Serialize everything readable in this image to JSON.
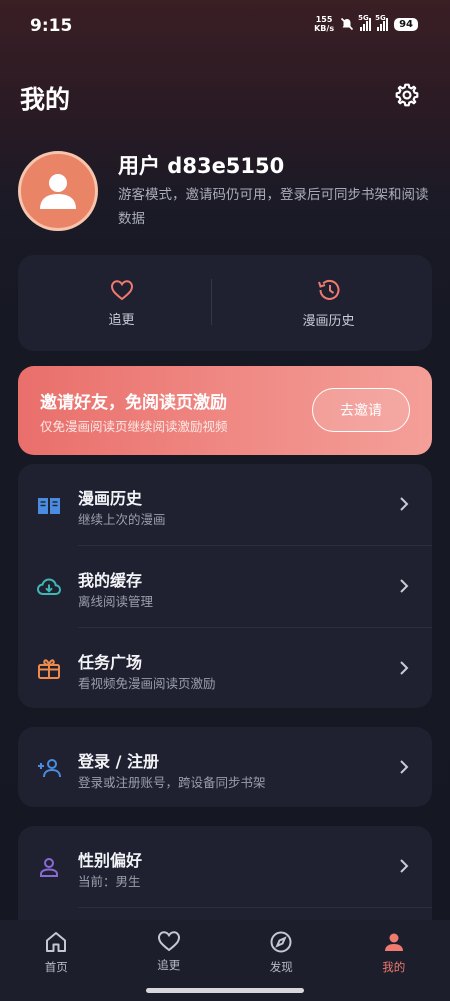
{
  "status_bar": {
    "time": "9:15",
    "net_speed_value": "155",
    "net_speed_unit": "KB/s",
    "sim1": "5G",
    "sim2": "5G",
    "battery": "94"
  },
  "header": {
    "title": "我的",
    "settings_icon": "gear-icon"
  },
  "profile": {
    "avatar_icon": "user-avatar-icon",
    "username": "用户 d83e5150",
    "description": "游客模式，邀请码仍可用，登录后可同步书架和阅读数据"
  },
  "quick_actions": [
    {
      "label": "追更",
      "icon": "heart-icon"
    },
    {
      "label": "漫画历史",
      "icon": "history-icon"
    }
  ],
  "invite": {
    "title": "邀请好友，免阅读页激励",
    "subtitle": "仅免漫画阅读页继续阅读激励视频",
    "button": "去邀请"
  },
  "menu_group_1": [
    {
      "title": "漫画历史",
      "subtitle": "继续上次的漫画",
      "icon": "book-icon"
    },
    {
      "title": "我的缓存",
      "subtitle": "离线阅读管理",
      "icon": "cloud-download-icon"
    },
    {
      "title": "任务广场",
      "subtitle": "看视频免漫画阅读页激励",
      "icon": "gift-icon"
    }
  ],
  "menu_group_2": [
    {
      "title": "登录 / 注册",
      "subtitle": "登录或注册账号，跨设备同步书架",
      "icon": "add-user-icon"
    }
  ],
  "menu_group_3": [
    {
      "title": "性别偏好",
      "subtitle": "当前：男生",
      "icon": "person-icon"
    }
  ],
  "bottom_nav": [
    {
      "label": "首页",
      "icon": "home-icon",
      "active": false
    },
    {
      "label": "追更",
      "icon": "heart-icon",
      "active": false
    },
    {
      "label": "发现",
      "icon": "compass-icon",
      "active": false
    },
    {
      "label": "我的",
      "icon": "profile-icon",
      "active": true
    }
  ],
  "colors": {
    "accent": "#ef7a70",
    "card": "#1f2130",
    "background": "#151723"
  }
}
